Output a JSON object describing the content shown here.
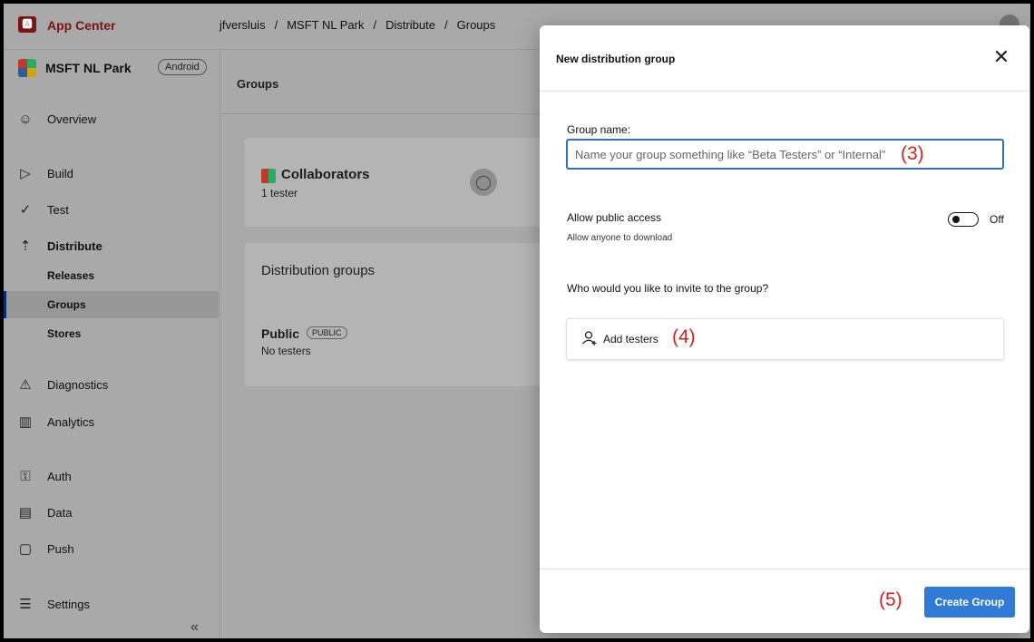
{
  "brand": {
    "logo": "🅰",
    "name": "App Center"
  },
  "breadcrumb": [
    "jfversluis",
    "MSFT NL Park",
    "Distribute",
    "Groups"
  ],
  "breadcrumb_separator": "/",
  "app": {
    "name": "MSFT NL Park",
    "platform": "Android"
  },
  "sidebar": {
    "items": [
      {
        "label": "Overview",
        "icon": "overview-icon",
        "glyph": "☺"
      },
      {
        "label": "Build",
        "icon": "build-icon",
        "glyph": "▷"
      },
      {
        "label": "Test",
        "icon": "test-icon",
        "glyph": "✓"
      },
      {
        "label": "Distribute",
        "icon": "distribute-icon",
        "glyph": "⇡"
      },
      {
        "label": "Diagnostics",
        "icon": "diagnostics-icon",
        "glyph": "⚠"
      },
      {
        "label": "Analytics",
        "icon": "analytics-icon",
        "glyph": "▥"
      },
      {
        "label": "Auth",
        "icon": "auth-icon",
        "glyph": "⚿"
      },
      {
        "label": "Data",
        "icon": "data-icon",
        "glyph": "▤"
      },
      {
        "label": "Push",
        "icon": "push-icon",
        "glyph": "▢"
      },
      {
        "label": "Settings",
        "icon": "settings-icon",
        "glyph": "☰"
      }
    ],
    "distribute_sub": [
      "Releases",
      "Groups",
      "Stores"
    ],
    "active_sub": "Groups",
    "collapse_glyph": "«"
  },
  "main": {
    "title": "Groups",
    "collaborators": {
      "name": "Collaborators",
      "count": "1 tester"
    },
    "distribution_groups": {
      "title": "Distribution groups",
      "groups": [
        {
          "name": "Public",
          "badge": "PUBLIC",
          "subtitle": "No testers"
        }
      ]
    }
  },
  "modal": {
    "title": "New distribution group",
    "close_glyph": "✕",
    "group_name_label": "Group name:",
    "group_name_value": "",
    "group_name_placeholder": "Name your group something like “Beta Testers” or “Internal”",
    "annotation_3": "(3)",
    "public_access_label": "Allow public access",
    "public_access_sub": "Allow anyone to download",
    "public_access_state": "Off",
    "invite_label": "Who would you like to invite to the group?",
    "add_testers_label": "Add testers",
    "annotation_4": "(4)",
    "annotation_5": "(5)",
    "create_button": "Create Group"
  },
  "colors": {
    "accent": "#2f7bd6",
    "annotation": "#d32020",
    "brand": "#7b1412"
  }
}
